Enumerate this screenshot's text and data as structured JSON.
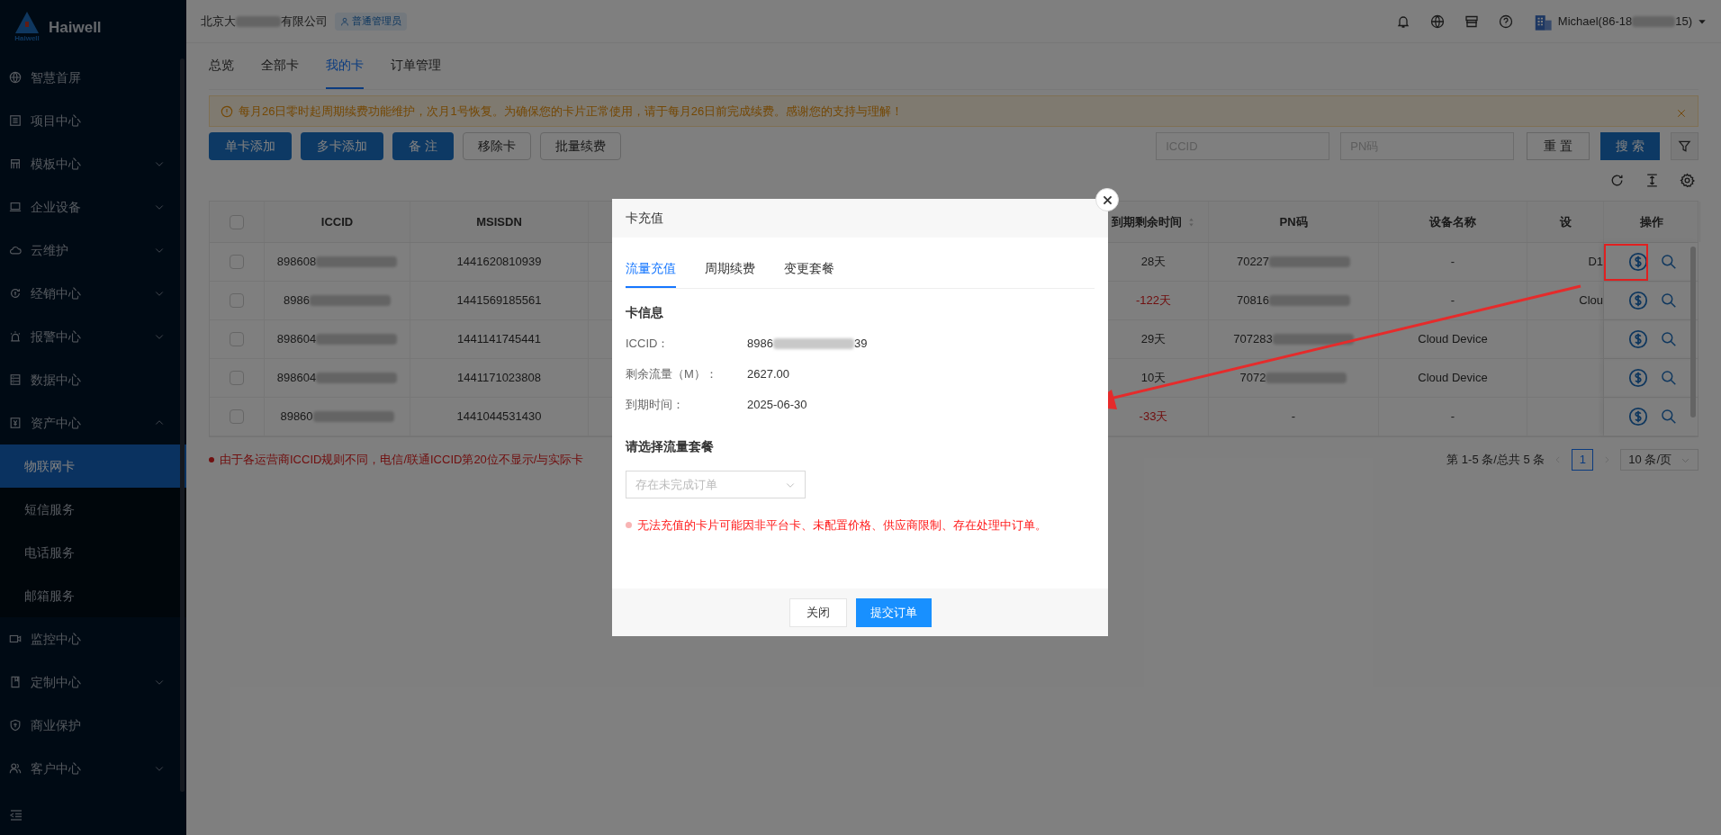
{
  "brand": {
    "name": "Haiwell",
    "logo_text": "Haiwell"
  },
  "sidebar": {
    "items": [
      {
        "label": "智慧首屏",
        "expandable": false
      },
      {
        "label": "项目中心",
        "expandable": false
      },
      {
        "label": "模板中心",
        "expandable": true,
        "expanded": false
      },
      {
        "label": "企业设备",
        "expandable": true,
        "expanded": false
      },
      {
        "label": "云维护",
        "expandable": true,
        "expanded": false
      },
      {
        "label": "经销中心",
        "expandable": true,
        "expanded": false
      },
      {
        "label": "报警中心",
        "expandable": true,
        "expanded": false
      },
      {
        "label": "数据中心",
        "expandable": false
      },
      {
        "label": "资产中心",
        "expandable": true,
        "expanded": true,
        "children": [
          {
            "label": "物联网卡",
            "selected": true
          },
          {
            "label": "短信服务",
            "selected": false
          },
          {
            "label": "电话服务",
            "selected": false
          },
          {
            "label": "邮箱服务",
            "selected": false
          }
        ]
      },
      {
        "label": "监控中心",
        "expandable": false
      },
      {
        "label": "定制中心",
        "expandable": true,
        "expanded": false
      },
      {
        "label": "商业保护",
        "expandable": false
      },
      {
        "label": "客户中心",
        "expandable": true,
        "expanded": false
      }
    ]
  },
  "header": {
    "company_start": "北京大",
    "company_end": "有限公司",
    "role": "普通管理员",
    "user_start": "Michael(86-18",
    "user_end": "15)"
  },
  "tabs": [
    {
      "label": "总览",
      "selected": false
    },
    {
      "label": "全部卡",
      "selected": false
    },
    {
      "label": "我的卡",
      "selected": true
    },
    {
      "label": "订单管理",
      "selected": false
    }
  ],
  "notice": {
    "text": "每月26日零时起周期续费功能维护，次月1号恢复。为确保您的卡片正常使用，请于每月26日前完成续费。感谢您的支持与理解！"
  },
  "toolbar": {
    "primary_buttons": [
      "单卡添加",
      "多卡添加",
      "备 注"
    ],
    "secondary_buttons": [
      "移除卡",
      "批量续费"
    ],
    "filters": [
      {
        "placeholder": "ICCID"
      },
      {
        "placeholder": "PN码"
      }
    ],
    "reset": "重 置",
    "search": "搜 索"
  },
  "table": {
    "all_checked": false,
    "columns": [
      "ICCID",
      "MSISDN",
      "到期剩余时间",
      "PN码",
      "设备名称",
      "设",
      "操作"
    ],
    "rows": [
      {
        "checked": false,
        "iccid": "898608",
        "msisdn": "1441620810939",
        "remaining": "28天",
        "overdue": false,
        "pn": "70227",
        "device_name": "-",
        "column_7": "D1",
        "highlighted": true
      },
      {
        "checked": false,
        "iccid": "8986",
        "msisdn": "1441569185561",
        "remaining": "-122天",
        "overdue": true,
        "pn": "70816",
        "device_name": "-",
        "column_7": "Clou",
        "highlighted": false
      },
      {
        "checked": false,
        "iccid": "898604",
        "msisdn": "1441141745441",
        "remaining": "29天",
        "overdue": false,
        "pn": "707283",
        "device_name": "Cloud Device",
        "highlighted": false
      },
      {
        "checked": false,
        "iccid": "898604",
        "msisdn": "1441171023808",
        "remaining": "10天",
        "overdue": false,
        "pn": "7072",
        "device_name": "Cloud Device",
        "highlighted": false
      },
      {
        "checked": false,
        "iccid": "89860",
        "msisdn": "1441044531430",
        "remaining": "-33天",
        "overdue": true,
        "pn": "-",
        "device_name": "-",
        "highlighted": false
      }
    ]
  },
  "footnote": "由于各运营商ICCID规则不同，电信/联通ICCID第20位不显示/与实际卡",
  "pagination": {
    "summary": "第 1-5 条/总共 5 条",
    "pages": [
      {
        "label": "1",
        "selected": true
      }
    ],
    "page_size": "10 条/页"
  },
  "modal": {
    "title": "卡充值",
    "tabs": [
      {
        "label": "流量充值",
        "selected": true
      },
      {
        "label": "周期续费",
        "selected": false
      },
      {
        "label": "变更套餐",
        "selected": false
      }
    ],
    "section": "卡信息",
    "fields": [
      {
        "label": "ICCID：",
        "value_start": "8986",
        "value_end": "39"
      },
      {
        "label": "剩余流量（M）：",
        "value_start": "2627.00"
      },
      {
        "label": "到期时间：",
        "value_start": "2025-06-30"
      }
    ],
    "package_label": "请选择流量套餐",
    "package_placeholder": "存在未完成订单",
    "warning": "无法充值的卡片可能因非平台卡、未配置价格、供应商限制、存在处理中订单。",
    "cancel": "关闭",
    "submit": "提交订单"
  }
}
